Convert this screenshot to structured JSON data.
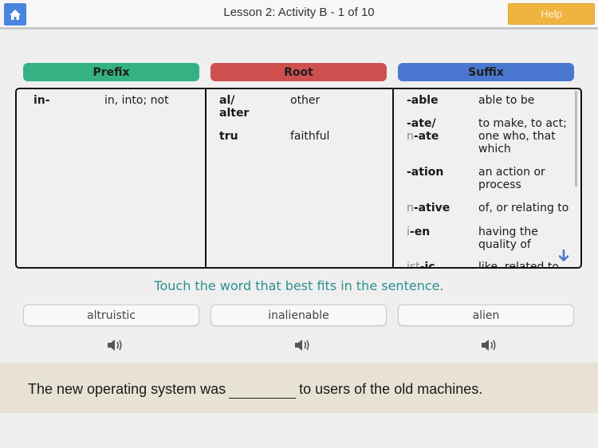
{
  "header": {
    "title": "Lesson 2:  Activity B - 1 of 10",
    "help_label": "Help",
    "home_icon": "home-icon"
  },
  "columns": {
    "prefix": {
      "label": "Prefix",
      "color": "#35b283",
      "entries": [
        {
          "term": "in-",
          "meaning": "in, into; not"
        }
      ]
    },
    "root": {
      "label": "Root",
      "color": "#d05050",
      "entries": [
        {
          "term_line1": "al/",
          "term_line2": "alter",
          "meaning": "other"
        },
        {
          "term": "tru",
          "meaning": "faithful"
        }
      ]
    },
    "suffix": {
      "label": "Suffix",
      "color": "#4a78d0",
      "entries": [
        {
          "term": "-able",
          "meaning": "able to be"
        },
        {
          "term_line1": "-ate/",
          "term_line2_dim": "n",
          "term_line2": "-ate",
          "meaning_line1": "to make, to act;",
          "meaning_line2": "one who, that",
          "meaning_line3": "which"
        },
        {
          "term": "-ation",
          "meaning_line1": "an action or",
          "meaning_line2": "process"
        },
        {
          "term_dim": "n",
          "term": "-ative",
          "meaning": "of, or relating to"
        },
        {
          "term_dim": "i",
          "term": "-en",
          "meaning_line1": "having the",
          "meaning_line2": "quality of"
        },
        {
          "term_dim": "ist",
          "term": "-ic",
          "meaning": "like, related to"
        }
      ]
    }
  },
  "instruction": "Touch the word that best fits in the sentence.",
  "choices": [
    {
      "label": "altruistic"
    },
    {
      "label": "inalienable"
    },
    {
      "label": "alien"
    }
  ],
  "sentence": {
    "before": "The new operating system was",
    "after": "to users of the old machines."
  },
  "colors": {
    "home_button": "#4a86e0",
    "help_button": "#efb33f",
    "instruction_text": "#2a9090",
    "sentence_background": "#e8e2d5"
  }
}
